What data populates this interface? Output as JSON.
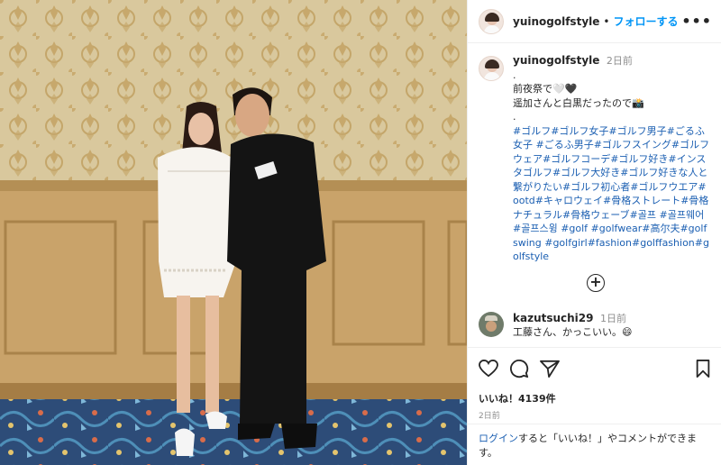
{
  "header": {
    "username": "yuinogolfstyle",
    "separator": "•",
    "follow_label": "フォローする",
    "more_icon": "ellipsis-icon"
  },
  "caption": {
    "username": "yuinogolfstyle",
    "time": "2日前",
    "line1": ".",
    "line2": "前夜祭で🤍🖤",
    "line3": "遥加さんと白黒だったので📸",
    "line4": ".",
    "hashtags": "#ゴルフ#ゴルフ女子#ゴルフ男子#ごるふ女子 #ごるふ男子#ゴルフスイング#ゴルフウェア#ゴルフコーデ#ゴルフ好き#インスタゴルフ#ゴルフ大好き#ゴルフ好きな人と繋がりたい#ゴルフ初心者#ゴルフウエア#ootd#キャロウェイ#骨格ストレート#骨格ナチュラル#骨格ウェーブ#골프 #골프웨어 #골프스윙 #golf #golfwear#高尔夫#golfswing #golfgirl#fashion#golffashion#golfstyle"
  },
  "more_comments_icon": "plus-circle-icon",
  "comment": {
    "username": "kazutsuchi29",
    "time": "1日前",
    "text": "工藤さん、かっこいい。😄"
  },
  "actions": {
    "like_icon": "heart-icon",
    "comment_icon": "comment-icon",
    "share_icon": "send-icon",
    "save_icon": "bookmark-icon",
    "likes": "いいね！4139件",
    "posted": "2日前"
  },
  "login_prompt": {
    "link": "ログイン",
    "rest": "すると「いいね！」やコメントができます。"
  }
}
